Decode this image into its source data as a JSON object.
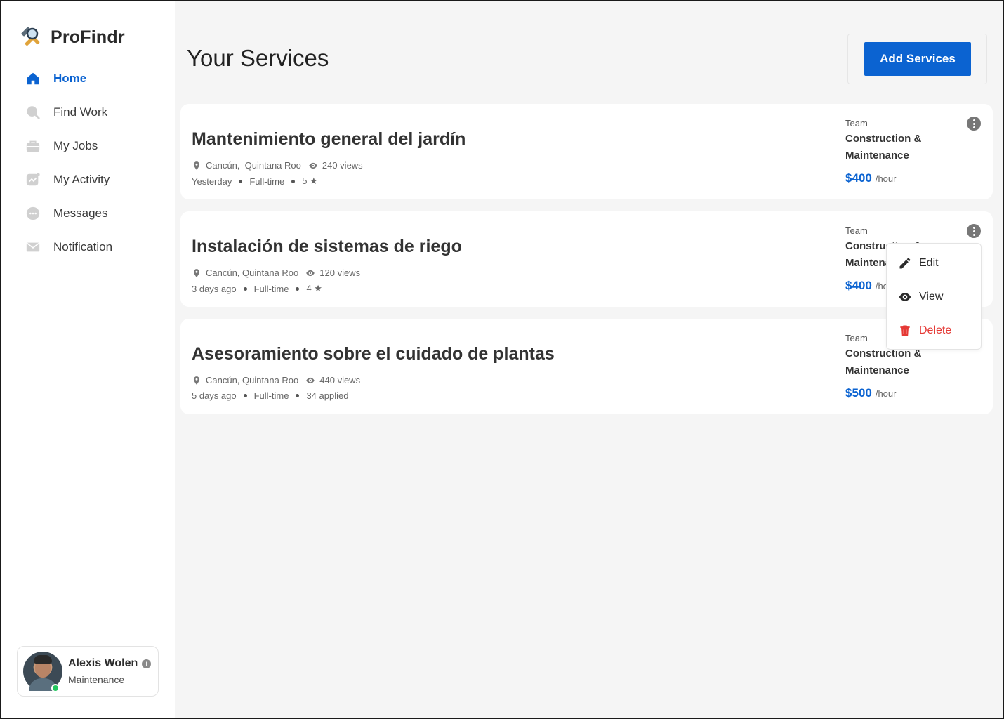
{
  "app": {
    "name": "ProFindr"
  },
  "sidebar": {
    "items": [
      {
        "label": "Home",
        "icon": "home-icon",
        "active": true
      },
      {
        "label": "Find Work",
        "icon": "search-icon",
        "active": false
      },
      {
        "label": "My Jobs",
        "icon": "briefcase-icon",
        "active": false
      },
      {
        "label": "My Activity",
        "icon": "activity-icon",
        "active": false
      },
      {
        "label": "Messages",
        "icon": "chat-icon",
        "active": false
      },
      {
        "label": "Notification",
        "icon": "mail-icon",
        "active": false
      }
    ]
  },
  "profile": {
    "name": "Alexis Wolen",
    "role": "Maintenance",
    "status": "online"
  },
  "header": {
    "title": "Your Services",
    "add_button": "Add Services"
  },
  "services": [
    {
      "title": "Mantenimiento general del jardín",
      "location": "Cancún,  Quintana Roo",
      "views": "240 views",
      "posted": "Yesterday",
      "type": "Full-time",
      "extra": "5 ★",
      "team_label": "Team",
      "team": "Construction & Maintenance",
      "price": "$400",
      "unit": "/hour"
    },
    {
      "title": "Instalación de sistemas de riego",
      "location": "Cancún, Quintana Roo",
      "views": "120 views",
      "posted": "3 days ago",
      "type": "Full-time",
      "extra": "4 ★",
      "team_label": "Team",
      "team": "Construction & Maintenance",
      "price": "$400",
      "unit": "/hour"
    },
    {
      "title": "Asesoramiento sobre el cuidado de plantas",
      "location": "Cancún, Quintana Roo",
      "views": "440 views",
      "posted": "5 days ago",
      "type": "Full-time",
      "extra": "34 applied",
      "team_label": "Team",
      "team": "Construction & Maintenance",
      "price": "$500",
      "unit": "/hour"
    }
  ],
  "context_menu": {
    "edit": "Edit",
    "view": "View",
    "delete": "Delete"
  },
  "colors": {
    "accent": "#0b63d1",
    "danger": "#e53935",
    "online": "#22c55e"
  }
}
